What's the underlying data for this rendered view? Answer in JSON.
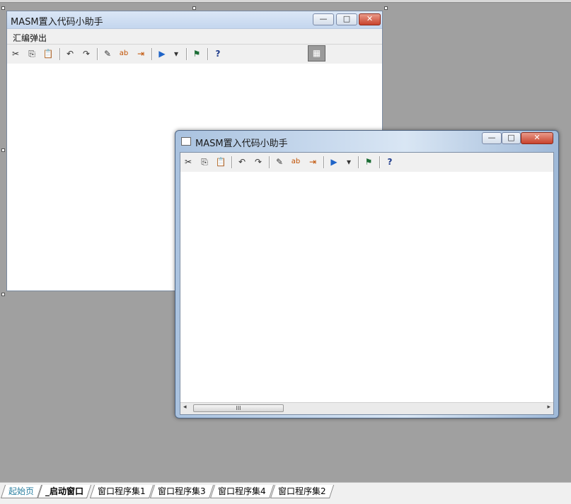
{
  "designer_form": {
    "title": "MASM置入代码小助手",
    "menu_item": "汇编弹出",
    "minimize": "—",
    "maximize": "□",
    "close": "✕"
  },
  "run_window": {
    "title": "MASM置入代码小助手",
    "minimize": "—",
    "maximize": "□",
    "close": "✕",
    "scroll_thumb_grip": "III",
    "scroll_left": "◂",
    "scroll_right": "▸"
  },
  "toolbar_glyphs": {
    "cut": "✂",
    "copy": "⎘",
    "paste": "📋",
    "undo": "↶",
    "redo": "↷",
    "highlight": "✎",
    "replace": "ab",
    "indent": "⇥",
    "run": "▶",
    "dropdown": "▾",
    "flag": "⚑",
    "help": "?"
  },
  "palette_glyph": "▦",
  "tabs": [
    {
      "label": "起始页"
    },
    {
      "label": "_启动窗口"
    },
    {
      "label": "窗口程序集1"
    },
    {
      "label": "窗口程序集3"
    },
    {
      "label": "窗口程序集4"
    },
    {
      "label": "窗口程序集2"
    }
  ],
  "icons": [
    "cut-icon",
    "copy-icon",
    "paste-icon",
    "undo-icon",
    "redo-icon",
    "highlight-icon",
    "replace-icon",
    "indent-icon",
    "run-icon",
    "dropdown-icon",
    "flag-icon",
    "help-icon",
    "palette-icon",
    "window-icon"
  ],
  "colors": {
    "workspace": "#a0a0a0",
    "active_tab_text": "#000000",
    "home_tab_text": "#2a7fa0"
  }
}
